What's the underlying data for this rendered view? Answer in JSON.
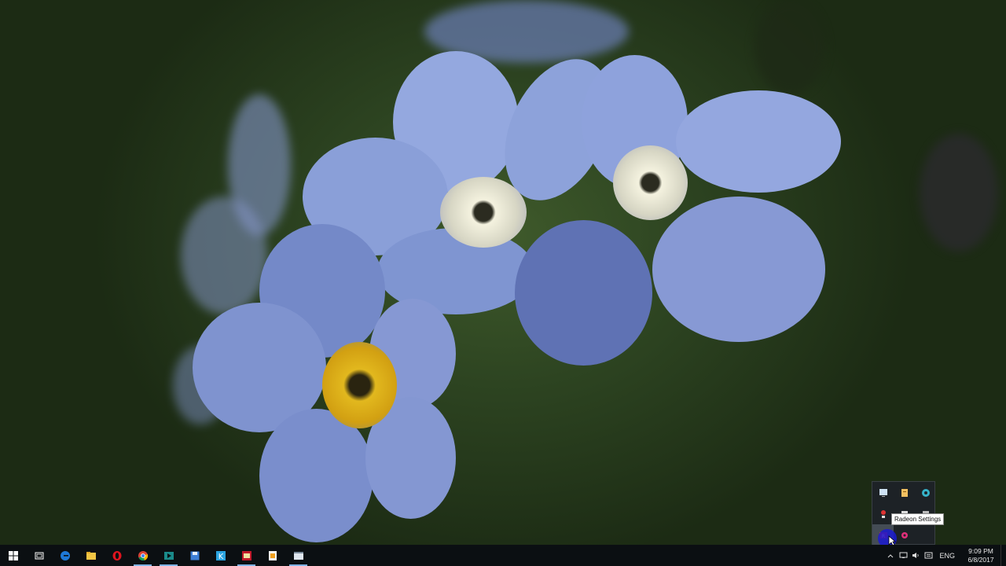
{
  "wallpaper": {
    "description_icon": "forget-me-not-flower-wallpaper"
  },
  "taskbar": {
    "apps": [
      {
        "name": "task-view-icon"
      },
      {
        "name": "edge-icon"
      },
      {
        "name": "file-explorer-icon"
      },
      {
        "name": "opera-icon"
      },
      {
        "name": "chrome-icon"
      },
      {
        "name": "video-editor-icon"
      },
      {
        "name": "save-disk-icon"
      },
      {
        "name": "app-k-icon"
      },
      {
        "name": "winrar-icon"
      },
      {
        "name": "document-icon"
      },
      {
        "name": "window-app-icon"
      }
    ],
    "language": "ENG",
    "time": "9:09 PM",
    "date": "6/8/2017"
  },
  "tray_overflow": {
    "tooltip": "Radeon Settings"
  },
  "colors": {
    "taskbar_bg": "#0b0f12",
    "accent": "#7fb2e5",
    "petal": "#8ea3dc"
  }
}
